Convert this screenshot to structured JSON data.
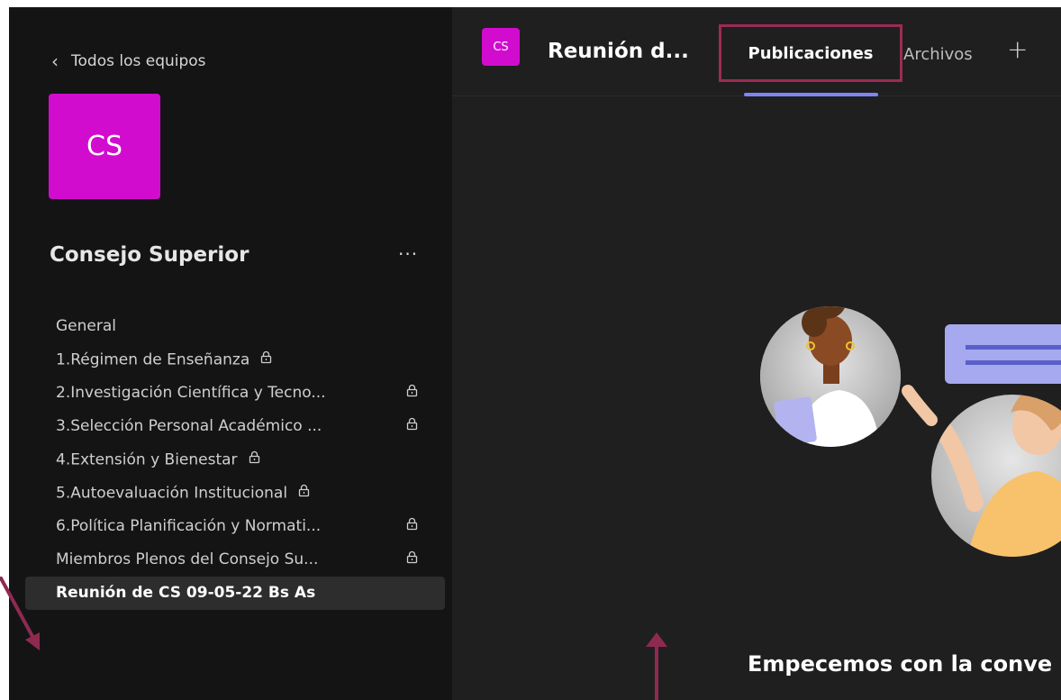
{
  "sidebar": {
    "back_label": "Todos los equipos",
    "team_avatar": "CS",
    "team_name": "Consejo Superior",
    "more_label": "···",
    "channels": [
      {
        "label": "General",
        "locked": false
      },
      {
        "label": "1.Régimen de Enseñanza",
        "locked": true
      },
      {
        "label": "2.Investigación Científica y Tecno...",
        "locked": true
      },
      {
        "label": "3.Selección Personal Académico ...",
        "locked": true
      },
      {
        "label": "4.Extensión y Bienestar",
        "locked": true
      },
      {
        "label": "5.Autoevaluación Institucional",
        "locked": true
      },
      {
        "label": "6.Política Planificación y Normati...",
        "locked": true
      },
      {
        "label": "Miembros Plenos del Consejo Su...",
        "locked": true
      },
      {
        "label": "Reunión de CS 09-05-22 Bs As",
        "locked": false
      }
    ]
  },
  "header": {
    "avatar": "CS",
    "title": "Reunión d...",
    "tabs": [
      {
        "label": "Publicaciones"
      },
      {
        "label": "Archivos"
      }
    ],
    "add_tab_icon": "+"
  },
  "main": {
    "empty_title": "Empecemos con la conve"
  },
  "colors": {
    "sidebar_bg": "#141414",
    "main_bg": "#1f1f1f",
    "team_avatar": "#d20ccf",
    "highlight_box": "#9c2b55",
    "tab_underline": "#7f85f5",
    "arrow": "#8e2a50"
  },
  "icons": {
    "back": "chevron-left-icon",
    "lock": "lock-icon",
    "add": "plus-icon"
  }
}
